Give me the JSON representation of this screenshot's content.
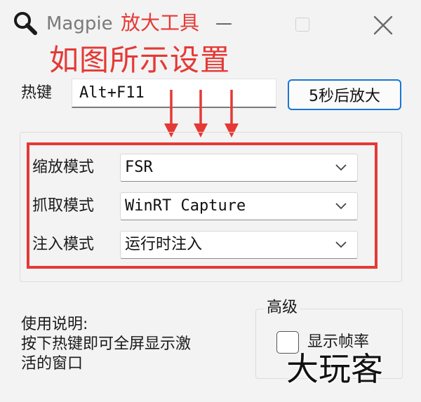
{
  "window": {
    "title": "Magpie",
    "annotation_title": "放大工具",
    "minimize_glyph": "—"
  },
  "annotation": {
    "heading": "如图所示设置",
    "color": "#e53935"
  },
  "hotkey": {
    "label": "热键",
    "value": "Alt+F11"
  },
  "delay_button": {
    "label": "5秒后放大",
    "border_color": "#1976d2"
  },
  "settings": {
    "scaling": {
      "label": "缩放模式",
      "value": "FSR"
    },
    "capture": {
      "label": "抓取模式",
      "value": "WinRT Capture"
    },
    "inject": {
      "label": "注入模式",
      "value": "运行时注入"
    }
  },
  "usage": {
    "title": "使用说明:",
    "line1": "按下热键即可全屏显示激",
    "line2": "活的窗口"
  },
  "advanced": {
    "title": "高级",
    "show_fps": {
      "label": "显示帧率",
      "checked": false
    }
  },
  "watermark": {
    "text": "大玩客"
  },
  "icons": {
    "app": "magnifier-icon",
    "minimize": "minimize-icon",
    "maximize": "maximize-icon",
    "close": "close-icon",
    "dropdown": "chevron-down-icon",
    "arrow": "arrow-down-icon"
  }
}
